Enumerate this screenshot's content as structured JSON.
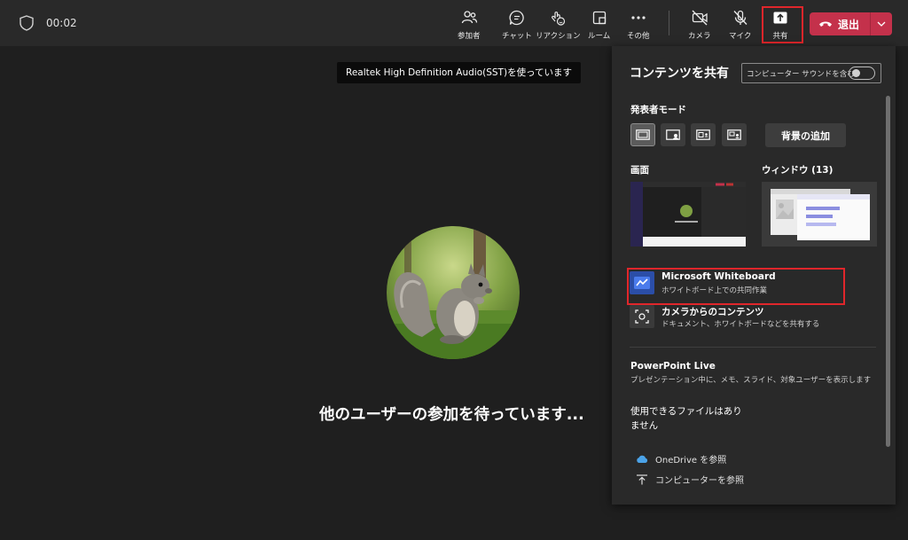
{
  "call": {
    "timer": "00:02"
  },
  "toolbar": {
    "participants": "参加者",
    "chat": "チャット",
    "reactions": "リアクション",
    "rooms": "ルーム",
    "more": "その他",
    "camera": "カメラ",
    "mic": "マイク",
    "share": "共有",
    "leave": "退出"
  },
  "stage": {
    "tooltip": "Realtek High Definition Audio(SST)を使っています",
    "waiting": "他のユーザーの参加を待っています..."
  },
  "share_panel": {
    "title": "コンテンツを共有",
    "computer_sound": "コンピューター サウンドを含む",
    "presenter_mode": "発表者モード",
    "add_background": "背景の追加",
    "screen": "画面",
    "window": "ウィンドウ (13)",
    "whiteboard": {
      "title": "Microsoft Whiteboard",
      "subtitle": "ホワイトボード上での共同作業"
    },
    "camera_content": {
      "title": "カメラからのコンテンツ",
      "subtitle": "ドキュメント、ホワイトボードなどを共有する"
    },
    "powerpoint_live": {
      "title": "PowerPoint Live",
      "subtitle": "プレゼンテーション中に、メモ、スライド、対象ユーザーを表示します"
    },
    "no_files": "使用できるファイルはありません",
    "browse_onedrive": "OneDrive を参照",
    "browse_computer": "コンピューターを参照"
  },
  "colors": {
    "leave_red": "#c4314b",
    "highlight_red": "#e0262b",
    "panel_bg": "#292929",
    "stage_bg": "#1f1f1f"
  }
}
